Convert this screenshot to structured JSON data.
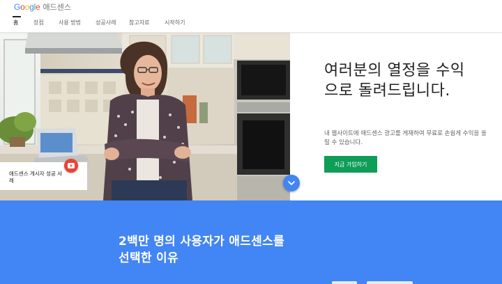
{
  "header": {
    "logo_letters": [
      "G",
      "o",
      "o",
      "g",
      "l",
      "e"
    ],
    "logo_colors": [
      "#4285f4",
      "#ea4335",
      "#fbbc05",
      "#4285f4",
      "#34a853",
      "#ea4335"
    ],
    "product": "애드센스",
    "nav": [
      {
        "label": "홈",
        "active": true
      },
      {
        "label": "장점",
        "active": false
      },
      {
        "label": "사용 방법",
        "active": false
      },
      {
        "label": "성공사례",
        "active": false
      },
      {
        "label": "참고자료",
        "active": false
      },
      {
        "label": "시작하기",
        "active": false
      }
    ]
  },
  "hero": {
    "headline": "여러분의 열정을 수익으로 돌려드립니다.",
    "subtext": "내 웹사이트에 애드센스 광고를 게재하여 무료로 손쉽게 수익을 올릴 수 있습니다.",
    "cta_label": "지금 가입하기",
    "story_label": "애드센스 게시자 성공 사례",
    "play_icon": "play-icon",
    "scroll_icon": "chevron-down-icon"
  },
  "band": {
    "title": "2백만 명의 사용자가 애드센스를 선택한 이유"
  },
  "colors": {
    "cta_green": "#0f9d58",
    "brand_blue": "#4285f4",
    "play_red": "#ea4335"
  }
}
